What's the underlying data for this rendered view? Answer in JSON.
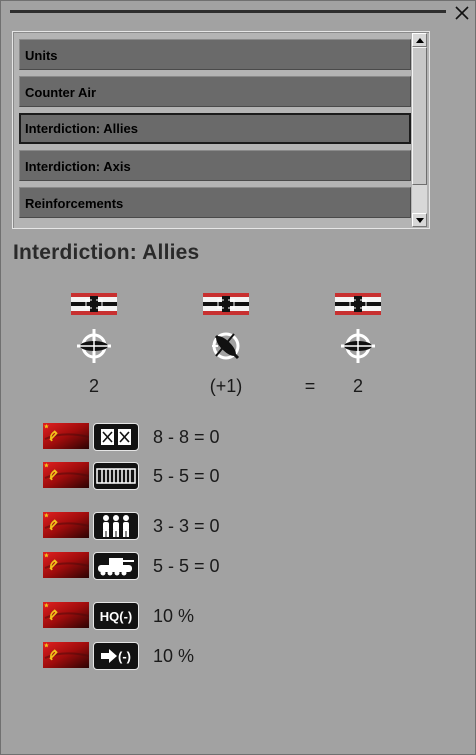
{
  "dialog": {
    "close_symbol": "✕"
  },
  "list": {
    "items": [
      {
        "label": "Units",
        "selected": false
      },
      {
        "label": "Counter Air",
        "selected": false
      },
      {
        "label": "Interdiction: Allies",
        "selected": true
      },
      {
        "label": "Interdiction: Axis",
        "selected": false
      },
      {
        "label": "Reinforcements",
        "selected": false
      }
    ]
  },
  "section": {
    "title": "Interdiction: Allies"
  },
  "summary": {
    "columns": [
      {
        "icon": "german-flag-icon",
        "symbol": "air-target-icon",
        "value": "2"
      },
      {
        "icon": "german-flag-icon",
        "symbol": "ground-attack-icon",
        "value": "(+1)"
      },
      {
        "icon": "german-flag-icon",
        "symbol": "air-target-icon",
        "value": "2"
      }
    ],
    "equals": "="
  },
  "rows": [
    {
      "flag": "soviet-flag-icon",
      "icon": "supply-depot-icon",
      "text": "8 - 8 = 0"
    },
    {
      "flag": "soviet-flag-icon",
      "icon": "rail-icon",
      "text": "5 - 5 = 0"
    },
    {
      "flag": "soviet-flag-icon",
      "icon": "infantry-icon",
      "text": "3 - 3 = 0"
    },
    {
      "flag": "soviet-flag-icon",
      "icon": "tank-icon",
      "text": "5 - 5 = 0"
    },
    {
      "flag": "soviet-flag-icon",
      "icon": "hq-icon",
      "icon_text": "HQ(-)",
      "text": "10 %"
    },
    {
      "flag": "soviet-flag-icon",
      "icon": "move-icon",
      "icon_text": "(-)",
      "text": "10 %"
    }
  ],
  "colors": {
    "background": "#a2a2a2",
    "list_item": "#6a6a6a",
    "soviet_red": "#b01010",
    "german_red": "#c83030"
  }
}
